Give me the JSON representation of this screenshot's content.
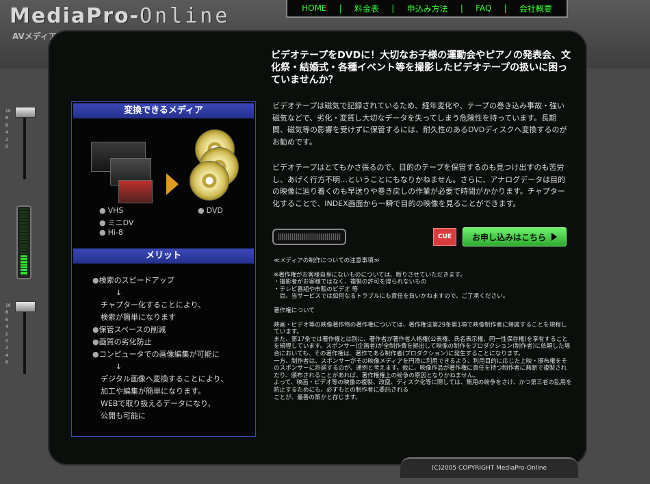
{
  "brand": {
    "logo_main": "MediaPro",
    "logo_dash": "-",
    "logo_online": "Online",
    "logo_sub": "AVメディア変換サービス"
  },
  "nav": {
    "items": [
      "HOME",
      "料金表",
      "申込み方法",
      "FAQ",
      "会社概要"
    ],
    "separator": "|"
  },
  "left": {
    "media_header": "変換できるメディア",
    "media_items": [
      "VHS",
      "ミニDV",
      "Hi-8"
    ],
    "dvd_label": "DVD",
    "merit_header": "メリット",
    "merits": [
      {
        "t": "検索のスピードアップ",
        "k": "bul"
      },
      {
        "t": "↓",
        "k": "arr"
      },
      {
        "t": "チャプター化することにより、",
        "k": "ind"
      },
      {
        "t": "検索が簡単になります",
        "k": "ind"
      },
      {
        "t": "保管スペースの削減",
        "k": "bul"
      },
      {
        "t": "画質の劣化防止",
        "k": "bul"
      },
      {
        "t": "コンピュータでの画像編集が可能に",
        "k": "bul"
      },
      {
        "t": "↓",
        "k": "arr"
      },
      {
        "t": "デジタル画像へ変換することにより、",
        "k": "ind"
      },
      {
        "t": "加工や編集が簡単になります。",
        "k": "ind"
      },
      {
        "t": "WEBで取り扱えるデータになり、",
        "k": "ind"
      },
      {
        "t": "公開も可能に",
        "k": "ind"
      }
    ]
  },
  "headline": "ビデオテープをDVDに！大切なお子様の運動会やピアノの発表会、文化祭・結婚式・各種イベント等を撮影したビデオテープの扱いに困っていませんか？",
  "para1": "ビデオテープは磁気で記録されているため、経年変化や、テープの巻き込み事故・強い磁気などで、劣化・変質し大切なデータを失ってしまう危険性を持っています。長期間、磁気等の影響を受けずに保管するには、耐久性のあるDVDディスクへ変換するのがお勧めです。",
  "para2": "ビデオテープはとてもかさ張るので、目的のテープを保管するのも見つけ出すのも苦労し、あげく行方不明…ということにもなりかねません。さらに、アナログデータは目的の映像に辿り着くのも早送りや巻き戻しの作業が必要で時間がかかります。チャプター化することで、INDEX画面から一瞬で目的の映像を見ることができます。",
  "buttons": {
    "cue": "CUE",
    "apply": "お申し込みはこちら"
  },
  "notes": [
    "≪メディアの制作についての注意事項≫",
    "",
    "※著作権がお客様自身にないものについては、断りさせていただきます。",
    "・撮影者がお客様ではなく、複製の許可を得られないもの",
    "・テレビ番組や市販のビデオ 等",
    "　尚、当サービスでは如何なるトラブルにも責任を負いかねますので、ご了承ください。",
    "",
    "著作権について",
    "",
    "映画・ビデオ等の映像著作物の著作権については、著作権法第29条第1項で映像制作者に帰属することを規程しています。",
    "また、第17条では著作権とは別に、著作者が著作者人格権(公表権、氏名表示権、同一性保存権)を享有することを規程しています。スポンサー(企画者)が全制作費を拠出して映像の制作をプロダクション(制作者)に依頼した場合においても、その著作権は、著作である制作者(プロダクション)に発生することになります。",
    "一方、制作者は、スポンサーがその映像メディアを円滑に利用できるよう、利用目的に応じた上映・頒布権をそのスポンサーに許諾するのが、通例と考えます。仮に、映像作品が著作権に責任を持つ制作者に無断で複製されたり、頒布されることがあれば、著作権権上の紛争の原因となりかねません。",
    "よって、映画・ビデオ等の映像の複製、改竄、ディスク化等に際しては、無用の紛争をさけ、かつ第三者の乱用を防止するためにも、必ずもとの制作者に委託される",
    "ことが、最善の策かと存じます。"
  ],
  "copyright": "(C)2005 COPYRIGHT MediaPro-Online",
  "slider_ticks": [
    "10",
    "8",
    "6",
    "4",
    "2",
    "0",
    "2",
    "4",
    "6"
  ],
  "meter_level": 0.3
}
